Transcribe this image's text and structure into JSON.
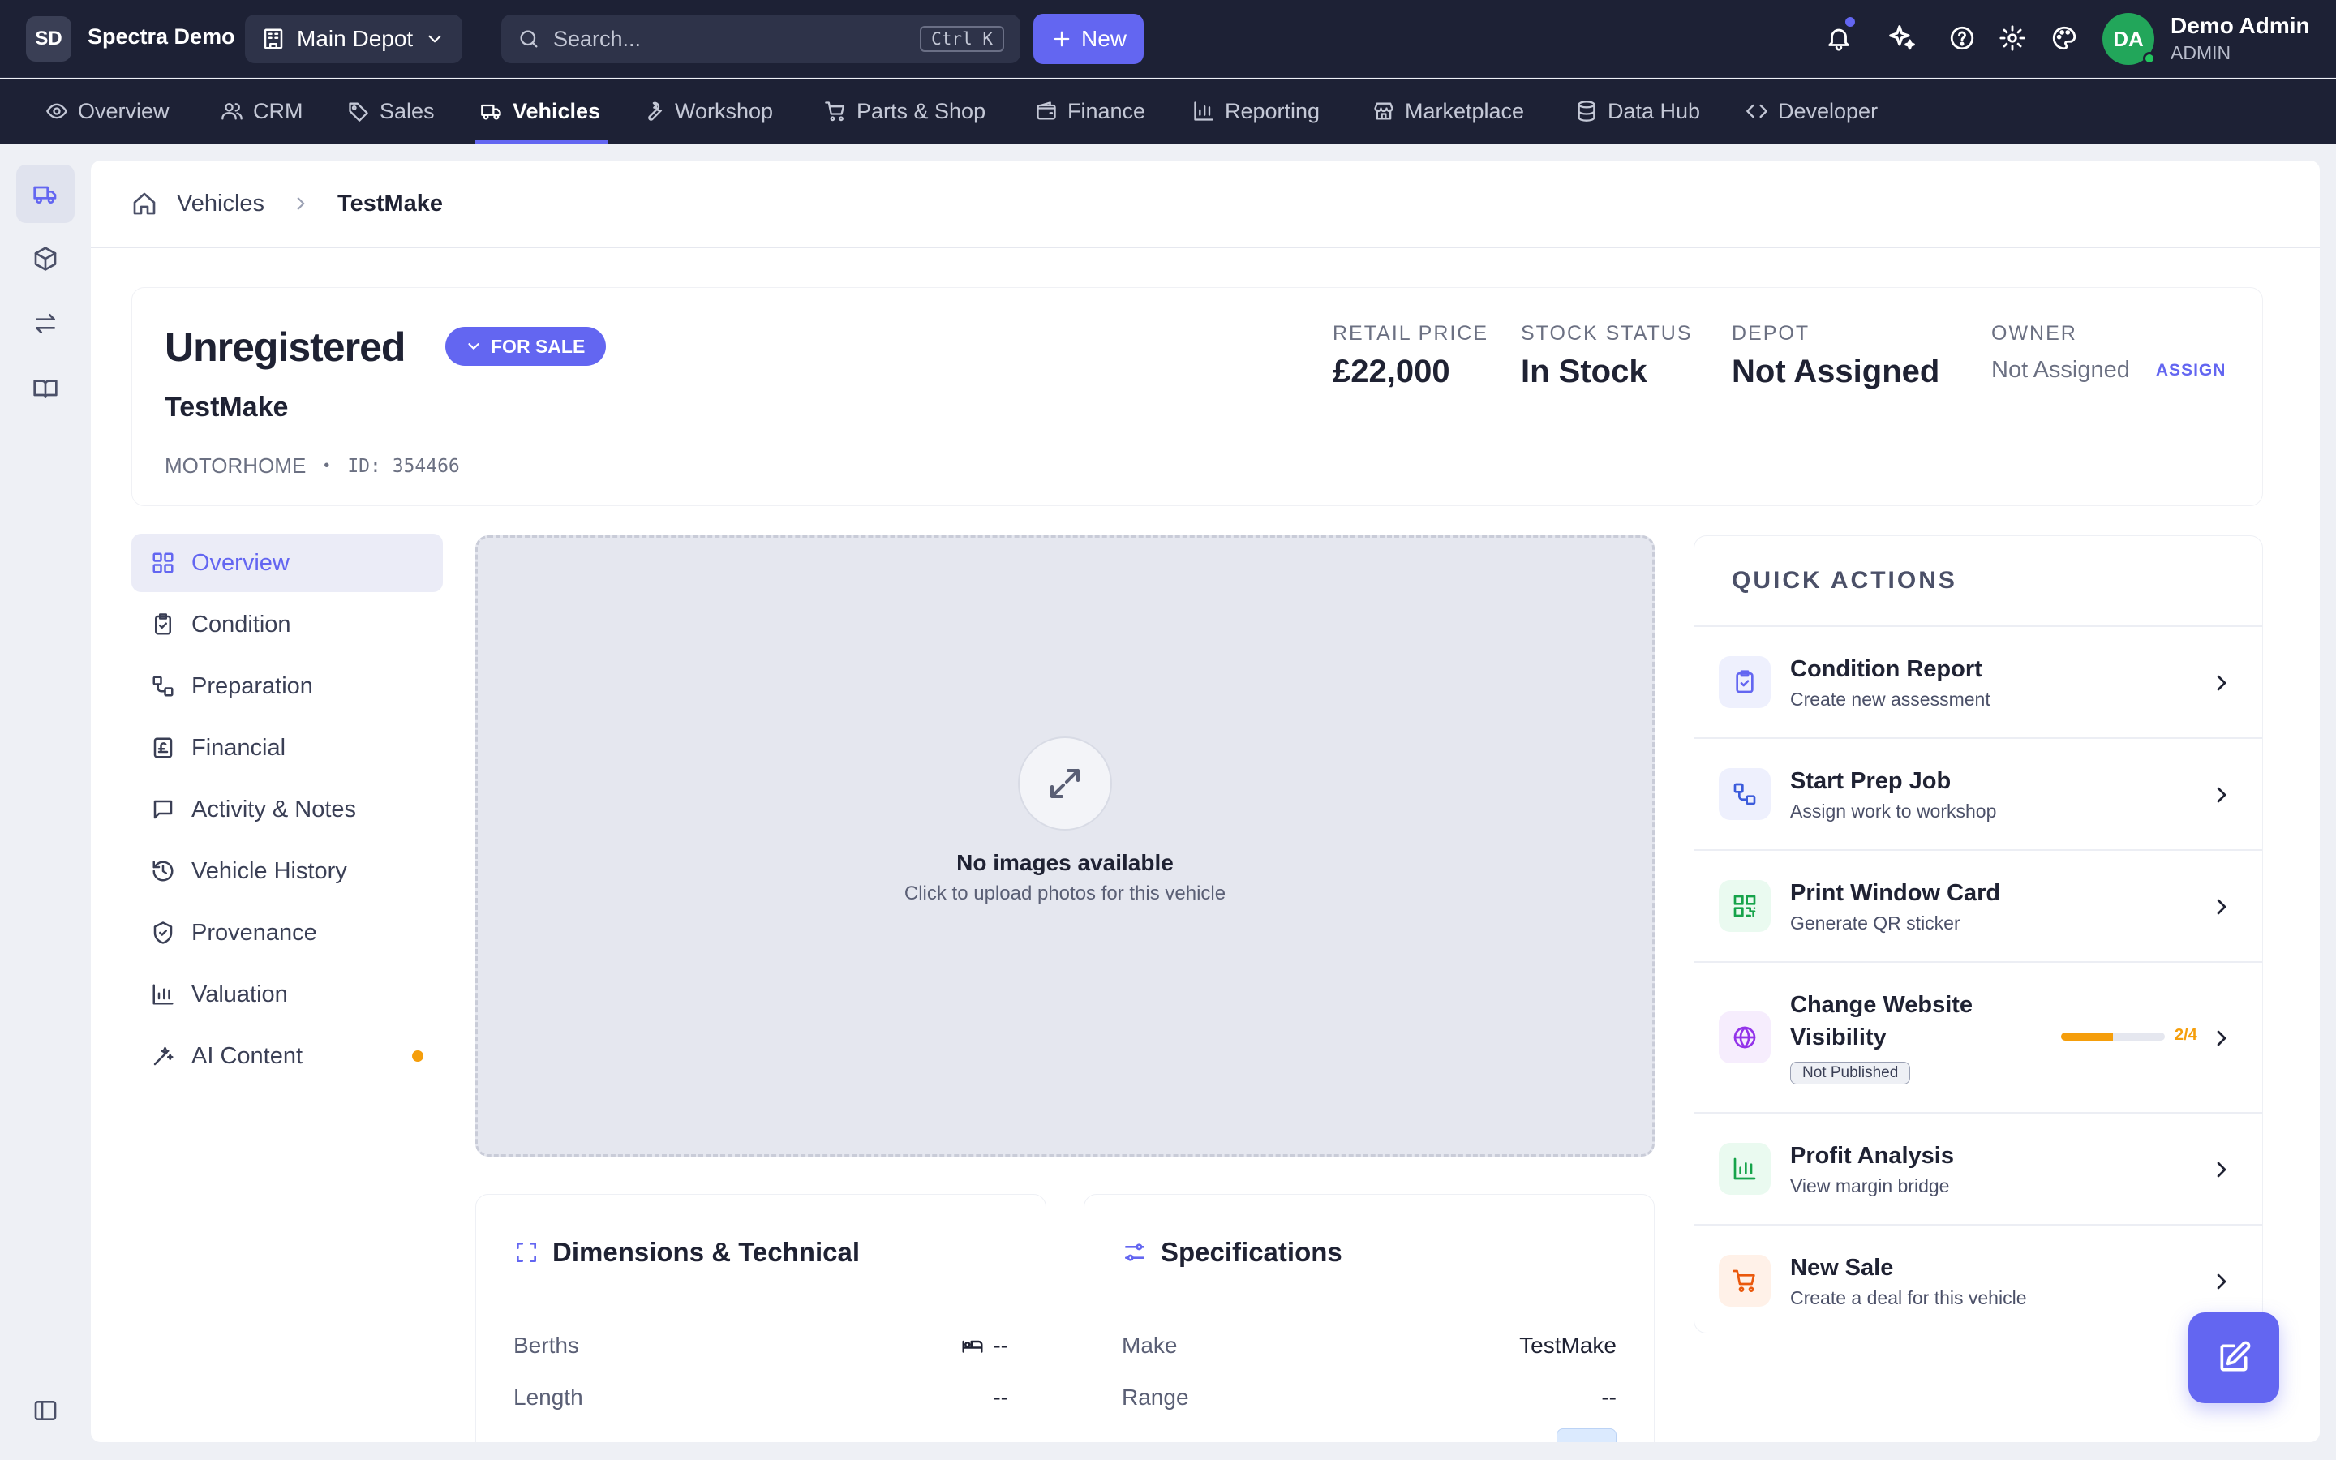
{
  "app": {
    "logo": "SD",
    "name": "Spectra Demo"
  },
  "depot_selector": {
    "label": "Main Depot",
    "icon": "building-icon"
  },
  "search": {
    "placeholder": "Search...",
    "shortcut": "Ctrl K"
  },
  "new_button": {
    "label": "New"
  },
  "user": {
    "initials": "DA",
    "name": "Demo Admin",
    "role": "ADMIN"
  },
  "nav": {
    "items": [
      {
        "label": "Overview",
        "icon": "eye-icon"
      },
      {
        "label": "CRM",
        "icon": "users-icon"
      },
      {
        "label": "Sales",
        "icon": "tag-icon"
      },
      {
        "label": "Vehicles",
        "icon": "van-icon",
        "active": true
      },
      {
        "label": "Workshop",
        "icon": "wrench-icon"
      },
      {
        "label": "Parts & Shop",
        "icon": "cart-icon"
      },
      {
        "label": "Finance",
        "icon": "wallet-icon"
      },
      {
        "label": "Reporting",
        "icon": "bar-chart-icon"
      },
      {
        "label": "Marketplace",
        "icon": "store-icon"
      },
      {
        "label": "Data Hub",
        "icon": "database-icon"
      },
      {
        "label": "Developer",
        "icon": "code-icon"
      }
    ]
  },
  "breadcrumb": {
    "root": "Vehicles",
    "current": "TestMake"
  },
  "vehicle": {
    "registration": "Unregistered",
    "status_badge": "FOR SALE",
    "make": "TestMake",
    "type": "MOTORHOME",
    "id_text": "ID: 354466"
  },
  "stats": {
    "retail_price": {
      "label": "RETAIL PRICE",
      "value": "£22,000"
    },
    "stock_status": {
      "label": "STOCK STATUS",
      "value": "In Stock"
    },
    "depot": {
      "label": "DEPOT",
      "value": "Not Assigned"
    },
    "owner": {
      "label": "OWNER",
      "value": "Not Assigned",
      "action": "ASSIGN"
    }
  },
  "tabs": [
    {
      "label": "Overview",
      "icon": "grid-icon",
      "active": true
    },
    {
      "label": "Condition",
      "icon": "clipboard-check-icon"
    },
    {
      "label": "Preparation",
      "icon": "workflow-icon"
    },
    {
      "label": "Financial",
      "icon": "pound-icon"
    },
    {
      "label": "Activity & Notes",
      "icon": "message-icon"
    },
    {
      "label": "Vehicle History",
      "icon": "history-icon"
    },
    {
      "label": "Provenance",
      "icon": "shield-check-icon"
    },
    {
      "label": "Valuation",
      "icon": "bar-chart-icon"
    },
    {
      "label": "AI Content",
      "icon": "magic-wand-icon",
      "dot": true
    }
  ],
  "gallery": {
    "title": "No images available",
    "subtitle": "Click to upload photos for this vehicle"
  },
  "dimensions": {
    "title": "Dimensions & Technical",
    "rows": [
      {
        "label": "Berths",
        "value": "--"
      },
      {
        "label": "Length",
        "value": "--"
      }
    ]
  },
  "specifications": {
    "title": "Specifications",
    "rows": [
      {
        "label": "Make",
        "value": "TestMake"
      },
      {
        "label": "Range",
        "value": "--"
      }
    ]
  },
  "quick_actions": {
    "title": "QUICK ACTIONS",
    "items": [
      {
        "title": "Condition Report",
        "subtitle": "Create new assessment",
        "icon": "clipboard-check-icon",
        "color": "#6366f1"
      },
      {
        "title": "Start Prep Job",
        "subtitle": "Assign work to workshop",
        "icon": "workflow-icon",
        "color": "#3b5bdb"
      },
      {
        "title": "Print Window Card",
        "subtitle": "Generate QR sticker",
        "icon": "qr-code-icon",
        "color": "#16a34a"
      },
      {
        "title": "Change Website Visibility",
        "badge": "Not Published",
        "progress": {
          "done": 2,
          "total": 4,
          "text": "2/4"
        },
        "icon": "globe-icon",
        "color": "#9333ea"
      },
      {
        "title": "Profit Analysis",
        "subtitle": "View margin bridge",
        "icon": "bar-chart-icon",
        "color": "#16a34a"
      },
      {
        "title": "New Sale",
        "subtitle": "Create a deal for this vehicle",
        "icon": "cart-icon",
        "color": "#ea580c"
      }
    ]
  },
  "colors": {
    "accent": "#6366f1",
    "topbar": "#1d2135",
    "warning": "#f59e0b",
    "online": "#22c55e"
  }
}
